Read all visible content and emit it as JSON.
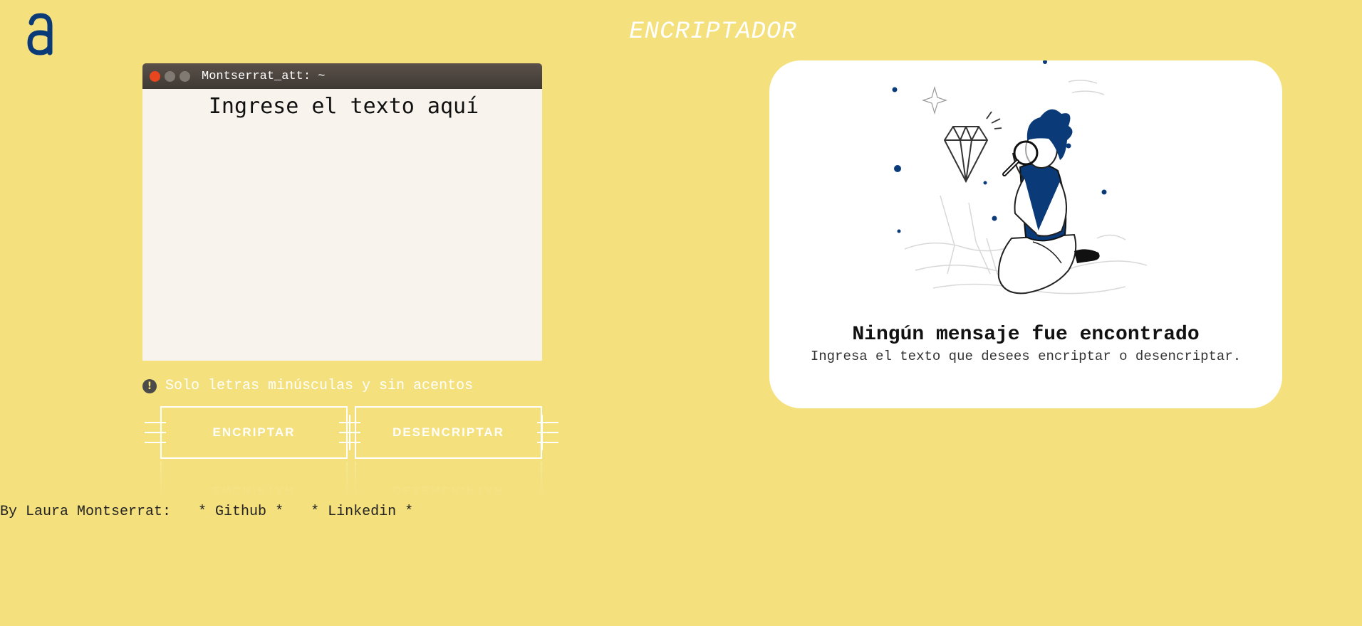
{
  "header": {
    "logo_icon": "letter-a-logo-icon",
    "title": "ENCRIPTADOR"
  },
  "terminal": {
    "window_title": "Montserrat_att: ~",
    "input_placeholder": "Ingrese el texto aquí",
    "input_value": ""
  },
  "hint": {
    "icon": "exclamation-circle-icon",
    "text": "Solo letras minúsculas y sin acentos"
  },
  "buttons": {
    "encrypt_label": "ENCRIPTAR",
    "decrypt_label": "DESENCRIPTAR"
  },
  "footer": {
    "author": "By Laura Montserrat:",
    "github": "* Github *",
    "linkedin": "* Linkedin *"
  },
  "output": {
    "illustration": "person-with-magnifying-glass-illustration",
    "title": "Ningún mensaje fue encontrado",
    "subtitle": "Ingresa el texto que desees encriptar o desencriptar."
  },
  "colors": {
    "background": "#f4e07c",
    "accent_blue": "#0a3a78",
    "terminal_bar": "#4a433d",
    "terminal_body": "#f8f3ec",
    "close_dot": "#e8461e"
  }
}
